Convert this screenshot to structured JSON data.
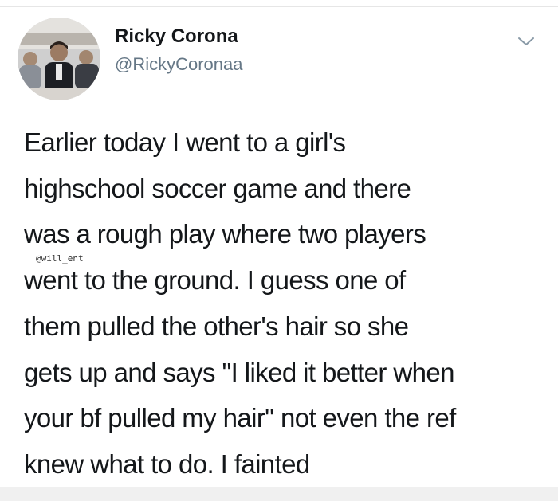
{
  "tweet": {
    "author_name": "Ricky Corona",
    "author_handle": "@RickyCoronaa",
    "text_lines": [
      "Earlier today I went to a girl's",
      "highschool soccer game and there",
      "was a rough play where two players",
      "went to the ground. I guess one of",
      "them pulled the other's hair so she",
      "gets up and says \"I liked it better when",
      "your bf pulled my hair\" not even the ref",
      "knew what to do. I fainted"
    ],
    "watermark": "@will_ent"
  },
  "icons": {
    "menu": "chevron-down-icon",
    "avatar": "avatar-photo"
  },
  "colors": {
    "text": "#14171a",
    "secondary": "#657786",
    "chevron": "#8899a6",
    "background": "#ffffff"
  }
}
